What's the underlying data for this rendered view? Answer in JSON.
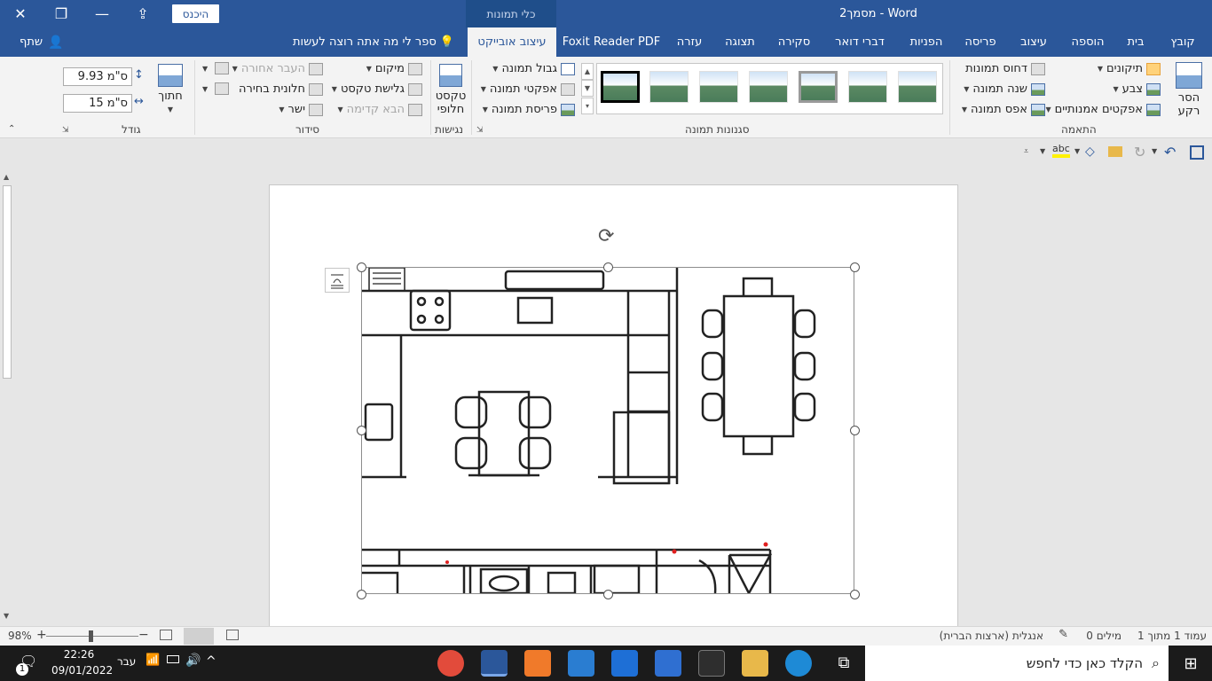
{
  "window": {
    "title": "מסמך2  -  Word",
    "signin": "היכנס",
    "context_group": "כלי תמונות"
  },
  "tabs": [
    {
      "label": "קובץ"
    },
    {
      "label": "בית"
    },
    {
      "label": "הוספה"
    },
    {
      "label": "עיצוב"
    },
    {
      "label": "פריסה"
    },
    {
      "label": "הפניות"
    },
    {
      "label": "דברי דואר"
    },
    {
      "label": "סקירה"
    },
    {
      "label": "תצוגה"
    },
    {
      "label": "עזרה"
    },
    {
      "label": "Foxit Reader PDF"
    },
    {
      "label": "עיצוב אובייקט"
    }
  ],
  "tellme": "ספר לי מה אתה רוצה לעשות",
  "share": "שתף",
  "ribbon": {
    "adjust": {
      "label": "התאמה",
      "remove_bg": "הסר רקע",
      "corrections": "תיקונים",
      "color": "צבע",
      "artistic": "אפקטים אמנותיים",
      "compress": "דחוס תמונות",
      "change": "שנה תמונה",
      "reset": "אפס תמונה"
    },
    "styles": {
      "label": "סגנונות תמונה",
      "border": "גבול תמונה",
      "effects": "אפקטי תמונה",
      "layout": "פריסת תמונה"
    },
    "access": {
      "label": "נגישות",
      "alt_text": "טקסט חלופי"
    },
    "arrange": {
      "label": "סידור",
      "position": "מיקום",
      "wrap": "גלישת טקסט",
      "bring_forward": "הבא קדימה",
      "send_backward": "העבר אחורה",
      "selection_pane": "חלונית בחירה",
      "align": "ישר"
    },
    "size": {
      "label": "גודל",
      "crop": "חתוך",
      "height": "9.93 ס\"מ",
      "width": "15 ס\"מ"
    }
  },
  "status": {
    "page": "עמוד 1 מתוך 1",
    "words": "0 מילים",
    "language": "אנגלית (ארצות הברית)",
    "zoom": "98%"
  },
  "taskbar": {
    "search_placeholder": "הקלד כאן כדי לחפש",
    "time": "22:26",
    "date": "09/01/2022",
    "lang": "עבר",
    "notif_count": "1"
  }
}
